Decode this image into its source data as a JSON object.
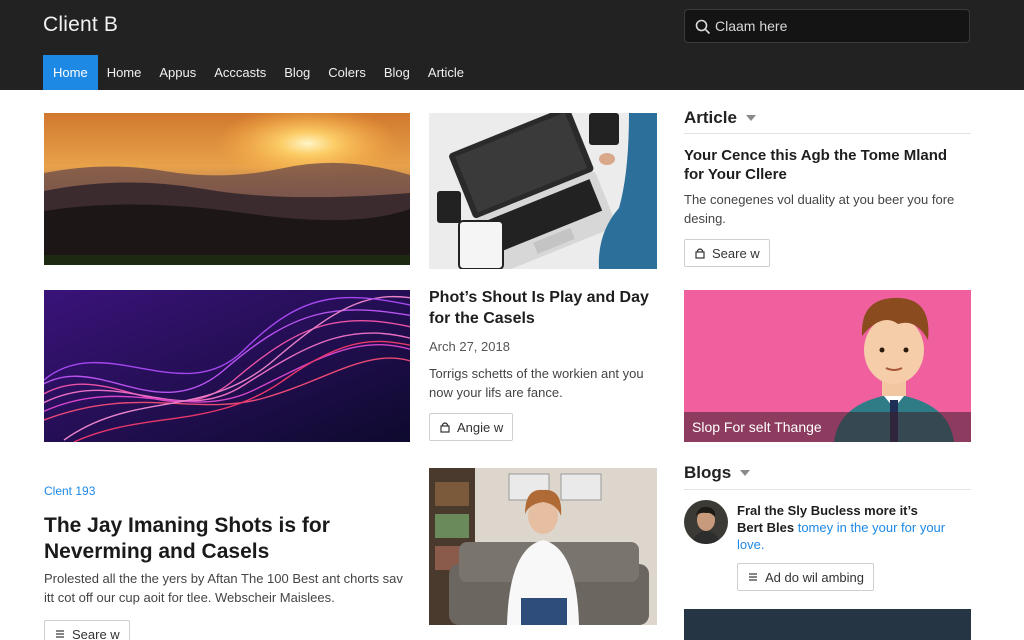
{
  "header": {
    "brand": "Client B",
    "search_placeholder": "Claam here",
    "nav": [
      "Home",
      "Home",
      "Appus",
      "Acccasts",
      "Blog",
      "Colers",
      "Blog",
      "Article"
    ]
  },
  "featured_post": {
    "title": "Phot’s Shout Is Play and Day for the Casels",
    "date": "Arch 27, 2018",
    "excerpt": "Torrigs schetts of the workien ant you now your lifs are fance.",
    "button": "Angie w"
  },
  "lead_post": {
    "kicker": "Clent 193",
    "title": "The Jay Imaning Shots is for Neverming and Casels",
    "excerpt": "Prolested all the the yers by Aftan The 100 Best ant chorts sav itt cot off our cup aoit for tlee. Webscheir Maislees.",
    "button": "Seare w"
  },
  "sidebar": {
    "article_heading": "Article",
    "article_title": "Your Cence this Agb the Tome Mland for Your Cllere",
    "article_excerpt": "The conegenes vol duality at you beer you fore desing.",
    "article_button": "Seare w",
    "promo_caption": "Slop For selt Thange",
    "blogs_heading": "Blogs",
    "blog_item_title": "Fral the Sly Bucless more it’s",
    "blog_item_author": "Bert Bles",
    "blog_item_link": "tomey in the your for your love.",
    "blog_item_button": "Ad do wil ambing"
  },
  "colors": {
    "header_bg": "#222222",
    "accent": "#1e88e5",
    "promo_bg": "#f0609f"
  },
  "icons": [
    "search-icon",
    "lock-icon",
    "list-icon",
    "chevron-down-icon"
  ]
}
